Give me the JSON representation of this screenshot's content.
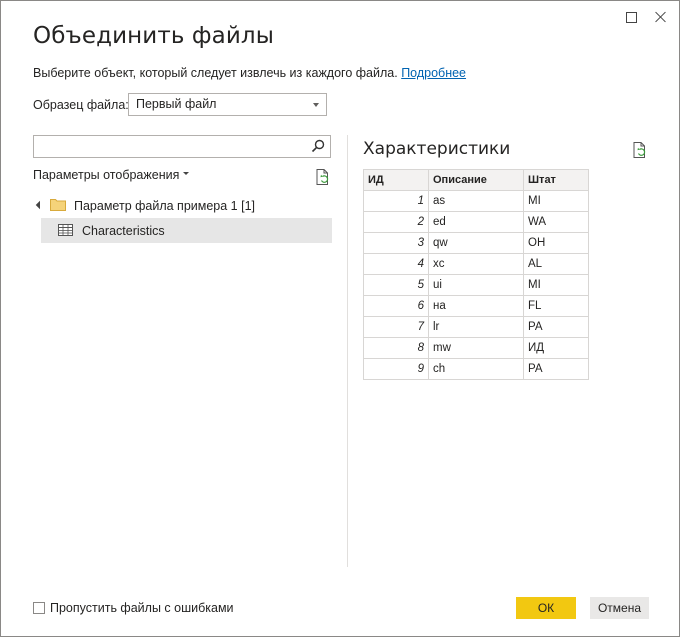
{
  "dialog": {
    "title": "Объединить файлы",
    "subtitle": "Выберите объект, который следует извлечь из каждого файла.",
    "learn_more": "Подробнее"
  },
  "sample_file": {
    "label": "Образец файла:",
    "selected": "Первый файл"
  },
  "navigator": {
    "search_placeholder": "",
    "display_options_label": "Параметры отображения",
    "folder": {
      "label": "Параметр файла примера 1 [1]",
      "icon": "folder-icon",
      "expanded": true
    },
    "items": [
      {
        "label": "Characteristics",
        "icon": "table-icon",
        "selected": true
      }
    ]
  },
  "preview": {
    "title": "Характеристики",
    "columns": [
      "ИД",
      "Описание",
      "Штат"
    ],
    "rows": [
      [
        "1",
        "as",
        "MI"
      ],
      [
        "2",
        "ed",
        "WA"
      ],
      [
        "3",
        "qw",
        "OH"
      ],
      [
        "4",
        "xc",
        "AL"
      ],
      [
        "5",
        "ui",
        "MI"
      ],
      [
        "6",
        "на",
        "FL"
      ],
      [
        "7",
        "lr",
        "PA"
      ],
      [
        "8",
        "mw",
        "ИД"
      ],
      [
        "9",
        "ch",
        "PA"
      ]
    ]
  },
  "footer": {
    "skip_errors_label": "Пропустить файлы с ошибками",
    "skip_errors_checked": false,
    "ok_label": "ОК",
    "cancel_label": "Отмена"
  },
  "colors": {
    "ok_button": "#f2c811",
    "cancel_button": "#e9e8e7",
    "link": "#0063b1",
    "selected_item": "#e6e6e6"
  }
}
